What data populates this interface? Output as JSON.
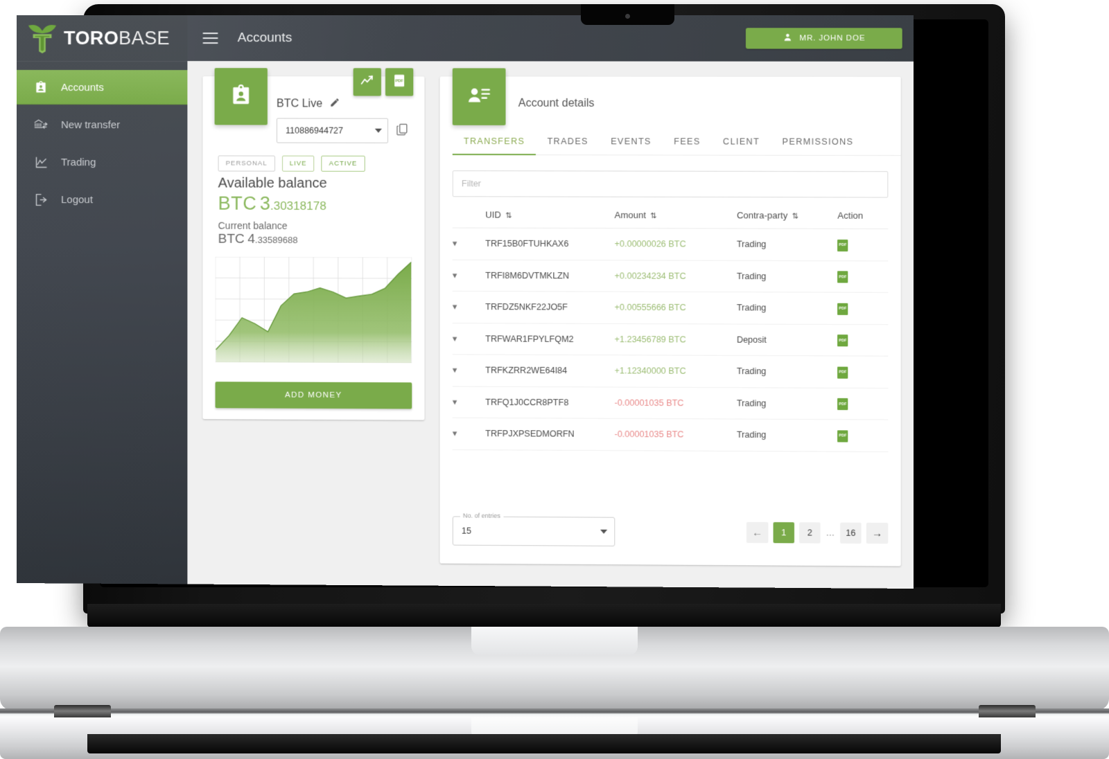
{
  "brand": {
    "name_bold": "TORO",
    "name_light": "BASE",
    "logo_icon": "bull-logo-icon"
  },
  "sidebar": {
    "items": [
      {
        "label": "Accounts",
        "icon": "id-badge-icon",
        "active": true
      },
      {
        "label": "New transfer",
        "icon": "bank-transfer-icon",
        "active": false
      },
      {
        "label": "Trading",
        "icon": "line-chart-icon",
        "active": false
      },
      {
        "label": "Logout",
        "icon": "logout-icon",
        "active": false
      }
    ]
  },
  "topbar": {
    "menu_icon": "hamburger-icon",
    "title": "Accounts",
    "user_icon": "person-icon",
    "user_label": "MR. JOHN DOE"
  },
  "account_card": {
    "avatar_icon": "id-badge-icon",
    "chart_button_icon": "trend-chart-icon",
    "pdf_button_icon": "pdf-icon",
    "name": "BTC Live",
    "edit_icon": "pencil-icon",
    "account_number": "110886944727",
    "copy_icon": "copy-icon",
    "badges": [
      "PERSONAL",
      "LIVE",
      "ACTIVE"
    ],
    "available_label": "Available balance",
    "available_unit": "BTC",
    "available_int": "3",
    "available_dec": ".30318178",
    "current_label": "Current balance",
    "current_unit": "BTC",
    "current_int": "4",
    "current_dec": ".33589688",
    "add_money_label": "ADD MONEY"
  },
  "details": {
    "avatar_icon": "account-details-icon",
    "title": "Account details",
    "tabs": [
      {
        "label": "TRANSFERS",
        "selected": true
      },
      {
        "label": "TRADES",
        "selected": false
      },
      {
        "label": "EVENTS",
        "selected": false
      },
      {
        "label": "FEES",
        "selected": false
      },
      {
        "label": "CLIENT",
        "selected": false
      },
      {
        "label": "PERMISSIONS",
        "selected": false
      }
    ],
    "filter_placeholder": "Filter",
    "columns": [
      "UID",
      "Amount",
      "Contra-party",
      "Action"
    ],
    "sort_icon": "sort-updown-icon",
    "expand_icon": "chevron-down-icon",
    "action_icon": "pdf-icon",
    "rows": [
      {
        "uid": "TRF15B0FTUHKAX6",
        "amount": "+0.00000026 BTC",
        "sign": "pos",
        "contra": "Trading"
      },
      {
        "uid": "TRFI8M6DVTMKLZN",
        "amount": "+0.00234234 BTC",
        "sign": "pos",
        "contra": "Trading"
      },
      {
        "uid": "TRFDZ5NKF22JO5F",
        "amount": "+0.00555666 BTC",
        "sign": "pos",
        "contra": "Trading"
      },
      {
        "uid": "TRFWAR1FPYLFQM2",
        "amount": "+1.23456789 BTC",
        "sign": "pos",
        "contra": "Deposit"
      },
      {
        "uid": "TRFKZRR2WE64I84",
        "amount": "+1.12340000 BTC",
        "sign": "pos",
        "contra": "Trading"
      },
      {
        "uid": "TRFQ1J0CCR8PTF8",
        "amount": "-0.00001035 BTC",
        "sign": "neg",
        "contra": "Trading"
      },
      {
        "uid": "TRFPJXPSEDMORFN",
        "amount": "-0.00001035 BTC",
        "sign": "neg",
        "contra": "Trading"
      }
    ],
    "entries_label": "No. of entries",
    "entries_value": "15",
    "pagination": {
      "prev_icon": "arrow-left-icon",
      "pages": [
        "1",
        "2",
        "…",
        "16"
      ],
      "current": "1",
      "next_icon": "arrow-right-icon"
    }
  },
  "colors": {
    "accent_green": "#7aab4a",
    "sidebar_dark": "#42474e",
    "amount_positive": "#9cbd74",
    "amount_negative": "#e98a8a"
  },
  "chart_data": {
    "type": "area",
    "title": "",
    "xlabel": "",
    "ylabel": "",
    "grid": true,
    "x": [
      0,
      1,
      2,
      3,
      4,
      5,
      6,
      7,
      8,
      9,
      10,
      11,
      12,
      13,
      14,
      15
    ],
    "values": [
      12,
      26,
      44,
      38,
      30,
      56,
      68,
      70,
      74,
      70,
      64,
      66,
      68,
      74,
      88,
      100
    ],
    "ylim": [
      0,
      100
    ],
    "series": [
      {
        "name": "balance",
        "values": [
          12,
          26,
          44,
          38,
          30,
          56,
          68,
          70,
          74,
          70,
          64,
          66,
          68,
          74,
          88,
          100
        ]
      }
    ]
  }
}
